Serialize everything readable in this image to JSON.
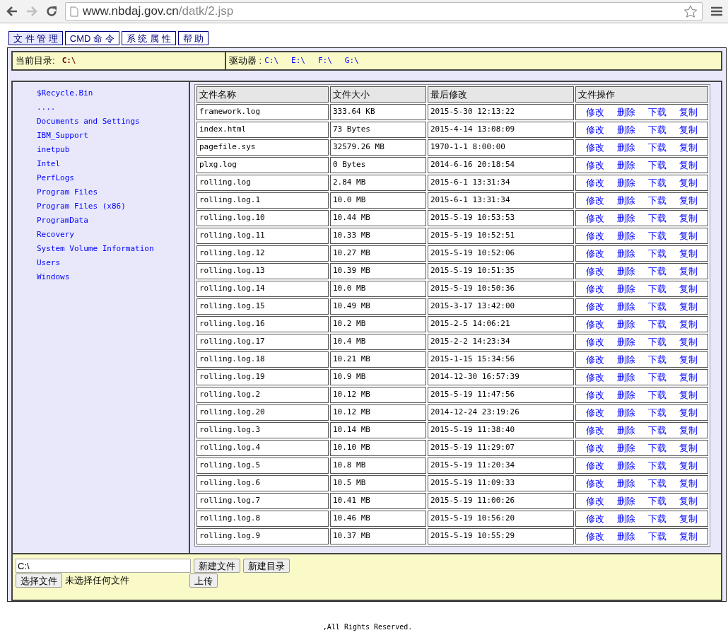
{
  "browser": {
    "url_host": "www.nbdaj.gov.cn",
    "url_path": "/datk/2.jsp",
    "back_disabled": false,
    "forward_disabled": true
  },
  "menu_tabs": [
    {
      "label": "文 件 管 理",
      "selected": true
    },
    {
      "label": "CMD 命 令",
      "selected": false
    },
    {
      "label": "系 统 属 性",
      "selected": false
    },
    {
      "label": "帮 助",
      "selected": false
    }
  ],
  "current_dir": {
    "label": "当前目录:",
    "value": "C:\\"
  },
  "drives": {
    "label": "驱动器 :",
    "items": [
      "C:\\",
      "E:\\",
      "F:\\",
      "G:\\"
    ]
  },
  "folders": [
    "$Recycle.Bin",
    "....",
    "Documents and Settings",
    "IBM_Support",
    "inetpub",
    "Intel",
    "PerfLogs",
    "Program Files",
    "Program Files (x86)",
    "ProgramData",
    "Recovery",
    "System Volume Information",
    "Users",
    "Windows"
  ],
  "table": {
    "columns": [
      "文件名称",
      "文件大小",
      "最后修改",
      "文件操作"
    ],
    "rows": [
      {
        "name": "framework.log",
        "size": "333.64 KB",
        "modified": "2015-5-30 12:13:22",
        "actions": [
          "修改",
          "删除",
          "下载",
          "复制"
        ]
      },
      {
        "name": "index.html",
        "size": "73 Bytes",
        "modified": "2015-4-14 13:08:09",
        "actions": [
          "修改",
          "删除",
          "下载",
          "复制"
        ]
      },
      {
        "name": "pagefile.sys",
        "size": "32579.26 MB",
        "modified": "1970-1-1 8:00:00",
        "actions": [
          "修改",
          "删除",
          "下载",
          "复制"
        ]
      },
      {
        "name": "plxg.log",
        "size": "0 Bytes",
        "modified": "2014-6-16 20:18:54",
        "actions": [
          "修改",
          "删除",
          "下载",
          "复制"
        ]
      },
      {
        "name": "rolling.log",
        "size": "2.84 MB",
        "modified": "2015-6-1 13:31:34",
        "actions": [
          "修改",
          "删除",
          "下载",
          "复制"
        ]
      },
      {
        "name": "rolling.log.1",
        "size": "10.0 MB",
        "modified": "2015-6-1 13:31:34",
        "actions": [
          "修改",
          "删除",
          "下载",
          "复制"
        ]
      },
      {
        "name": "rolling.log.10",
        "size": "10.44 MB",
        "modified": "2015-5-19 10:53:53",
        "actions": [
          "修改",
          "删除",
          "下载",
          "复制"
        ]
      },
      {
        "name": "rolling.log.11",
        "size": "10.33 MB",
        "modified": "2015-5-19 10:52:51",
        "actions": [
          "修改",
          "删除",
          "下载",
          "复制"
        ]
      },
      {
        "name": "rolling.log.12",
        "size": "10.27 MB",
        "modified": "2015-5-19 10:52:06",
        "actions": [
          "修改",
          "删除",
          "下载",
          "复制"
        ]
      },
      {
        "name": "rolling.log.13",
        "size": "10.39 MB",
        "modified": "2015-5-19 10:51:35",
        "actions": [
          "修改",
          "删除",
          "下载",
          "复制"
        ]
      },
      {
        "name": "rolling.log.14",
        "size": "10.0 MB",
        "modified": "2015-5-19 10:50:36",
        "actions": [
          "修改",
          "删除",
          "下载",
          "复制"
        ]
      },
      {
        "name": "rolling.log.15",
        "size": "10.49 MB",
        "modified": "2015-3-17 13:42:00",
        "actions": [
          "修改",
          "删除",
          "下载",
          "复制"
        ]
      },
      {
        "name": "rolling.log.16",
        "size": "10.2 MB",
        "modified": "2015-2-5 14:06:21",
        "actions": [
          "修改",
          "删除",
          "下载",
          "复制"
        ]
      },
      {
        "name": "rolling.log.17",
        "size": "10.4 MB",
        "modified": "2015-2-2 14:23:34",
        "actions": [
          "修改",
          "删除",
          "下载",
          "复制"
        ]
      },
      {
        "name": "rolling.log.18",
        "size": "10.21 MB",
        "modified": "2015-1-15 15:34:56",
        "actions": [
          "修改",
          "删除",
          "下载",
          "复制"
        ]
      },
      {
        "name": "rolling.log.19",
        "size": "10.9 MB",
        "modified": "2014-12-30 16:57:39",
        "actions": [
          "修改",
          "删除",
          "下载",
          "复制"
        ]
      },
      {
        "name": "rolling.log.2",
        "size": "10.12 MB",
        "modified": "2015-5-19 11:47:56",
        "actions": [
          "修改",
          "删除",
          "下载",
          "复制"
        ]
      },
      {
        "name": "rolling.log.20",
        "size": "10.12 MB",
        "modified": "2014-12-24 23:19:26",
        "actions": [
          "修改",
          "删除",
          "下载",
          "复制"
        ]
      },
      {
        "name": "rolling.log.3",
        "size": "10.14 MB",
        "modified": "2015-5-19 11:38:40",
        "actions": [
          "修改",
          "删除",
          "下载",
          "复制"
        ]
      },
      {
        "name": "rolling.log.4",
        "size": "10.10 MB",
        "modified": "2015-5-19 11:29:07",
        "actions": [
          "修改",
          "删除",
          "下载",
          "复制"
        ]
      },
      {
        "name": "rolling.log.5",
        "size": "10.8 MB",
        "modified": "2015-5-19 11:20:34",
        "actions": [
          "修改",
          "删除",
          "下载",
          "复制"
        ]
      },
      {
        "name": "rolling.log.6",
        "size": "10.5 MB",
        "modified": "2015-5-19 11:09:33",
        "actions": [
          "修改",
          "删除",
          "下载",
          "复制"
        ]
      },
      {
        "name": "rolling.log.7",
        "size": "10.41 MB",
        "modified": "2015-5-19 11:00:26",
        "actions": [
          "修改",
          "删除",
          "下载",
          "复制"
        ]
      },
      {
        "name": "rolling.log.8",
        "size": "10.46 MB",
        "modified": "2015-5-19 10:56:20",
        "actions": [
          "修改",
          "删除",
          "下载",
          "复制"
        ]
      },
      {
        "name": "rolling.log.9",
        "size": "10.37 MB",
        "modified": "2015-5-19 10:55:29",
        "actions": [
          "修改",
          "删除",
          "下载",
          "复制"
        ]
      }
    ]
  },
  "form": {
    "path_value": "C:\\",
    "buttons": [
      "新建文件",
      "新建目录"
    ],
    "choose_button": "选择文件",
    "file_status": "未选择任何文件",
    "upload_button": "上传"
  },
  "footer": ",All Rights Reserved."
}
